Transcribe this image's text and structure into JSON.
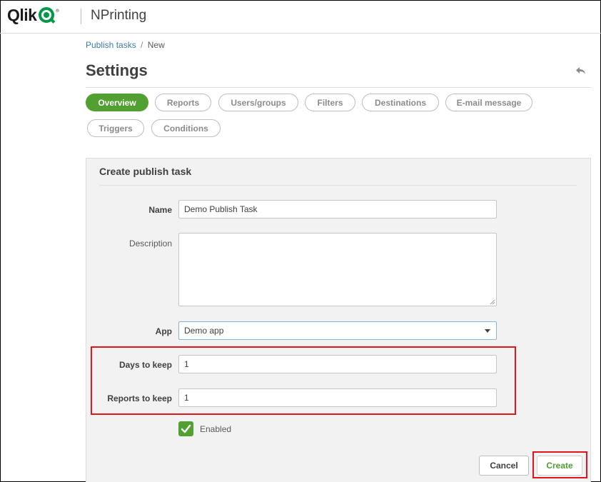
{
  "header": {
    "logo_text": "Qlik",
    "logo_tm": "®",
    "product_name": "NPrinting"
  },
  "breadcrumb": {
    "parent": "Publish tasks",
    "separator": "/",
    "current": "New"
  },
  "page": {
    "title": "Settings"
  },
  "tabs": [
    {
      "label": "Overview",
      "active": true
    },
    {
      "label": "Reports",
      "active": false
    },
    {
      "label": "Users/groups",
      "active": false
    },
    {
      "label": "Filters",
      "active": false
    },
    {
      "label": "Destinations",
      "active": false
    },
    {
      "label": "E-mail message",
      "active": false
    },
    {
      "label": "Triggers",
      "active": false
    },
    {
      "label": "Conditions",
      "active": false
    }
  ],
  "form": {
    "title": "Create publish task",
    "name_label": "Name",
    "name_value": "Demo Publish Task",
    "description_label": "Description",
    "description_value": "",
    "app_label": "App",
    "app_value": "Demo app",
    "days_label": "Days to keep",
    "days_value": "1",
    "reports_label": "Reports to keep",
    "reports_value": "1",
    "enabled_label": "Enabled",
    "enabled": true,
    "cancel_label": "Cancel",
    "create_label": "Create"
  },
  "colors": {
    "accent_green": "#52a032",
    "qlik_green": "#009845",
    "highlight_red": "#e1161c",
    "link_blue": "#3d7ab8"
  },
  "icons": {
    "undo": "undo-arrow-icon",
    "caret": "chevron-down-icon",
    "check": "checkmark-icon"
  }
}
